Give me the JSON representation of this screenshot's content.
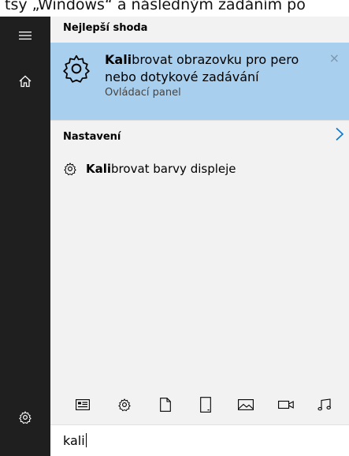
{
  "caption_fragment": "tsy „Windows“ a následným zadáním po",
  "sections": {
    "best_match": "Nejlepší shoda",
    "settings": "Nastavení"
  },
  "best_match": {
    "title_bold": "Kali",
    "title_rest": "brovat obrazovku pro pero nebo dotykové zadávání",
    "subtitle": "Ovládací panel",
    "close_glyph": "×"
  },
  "settings_results": [
    {
      "title_bold": "Kali",
      "title_rest": "brovat barvy displeje"
    }
  ],
  "search": {
    "query": "kali"
  },
  "icons": {
    "sidebar": [
      "hamburger-icon",
      "home-icon",
      "settings-icon"
    ],
    "filters": [
      "apps-icon",
      "settings-icon",
      "document-icon",
      "tablet-icon",
      "photo-icon",
      "video-icon",
      "music-icon"
    ]
  },
  "colors": {
    "sidebar_bg": "#1f1f1f",
    "highlight_bg": "#a9cfee",
    "panel_bg": "#f2f2f2",
    "accent": "#0078d7"
  }
}
